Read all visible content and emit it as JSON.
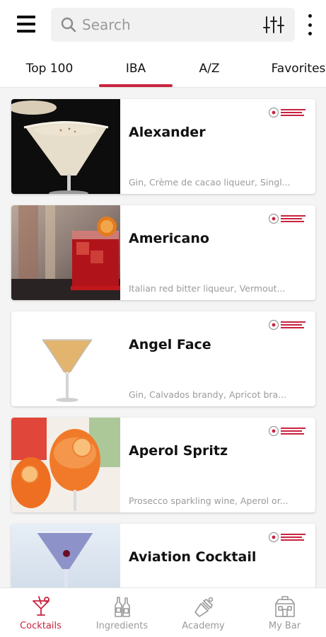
{
  "header": {
    "search_placeholder": "Search"
  },
  "tabs": [
    {
      "label": "Top 100",
      "active": false
    },
    {
      "label": "IBA",
      "active": true
    },
    {
      "label": "A/Z",
      "active": false
    },
    {
      "label": "Favorites",
      "active": false
    }
  ],
  "cocktails": [
    {
      "name": "Alexander",
      "ingredients": "Gin, Crème de cacao liqueur, Singl...",
      "badge": "INTERNATIONAL BARTENDERS ASSOCIATION",
      "image": "creamy-martini-glass"
    },
    {
      "name": "Americano",
      "ingredients": "Italian red bitter liqueur, Vermout...",
      "badge": "INTERNATIONAL BARTENDERS ASSOCIATION",
      "image": "red-rocks-glass"
    },
    {
      "name": "Angel Face",
      "ingredients": "Gin, Calvados brandy, Apricot bra...",
      "badge": "INTERNATIONAL BARTENDERS ASSOCIATION",
      "image": "amber-martini-glass"
    },
    {
      "name": "Aperol Spritz",
      "ingredients": "Prosecco sparkling wine, Aperol or...",
      "badge": "INTERNATIONAL BARTENDERS ASSOCIATION",
      "image": "orange-wine-glasses"
    },
    {
      "name": "Aviation Cocktail",
      "ingredients": "",
      "badge": "INTERNATIONAL BARTENDERS ASSOCIATION",
      "image": "violet-martini-glass"
    }
  ],
  "bottom_nav": [
    {
      "label": "Cocktails",
      "icon": "cocktail-glass-icon",
      "active": true
    },
    {
      "label": "Ingredients",
      "icon": "bottles-icon",
      "active": false
    },
    {
      "label": "Academy",
      "icon": "shaker-icon",
      "active": false
    },
    {
      "label": "My Bar",
      "icon": "bar-building-icon",
      "active": false
    }
  ],
  "colors": {
    "accent": "#c8233f",
    "inactive": "#9a9a9a",
    "search_bg": "#f1f1f1"
  }
}
